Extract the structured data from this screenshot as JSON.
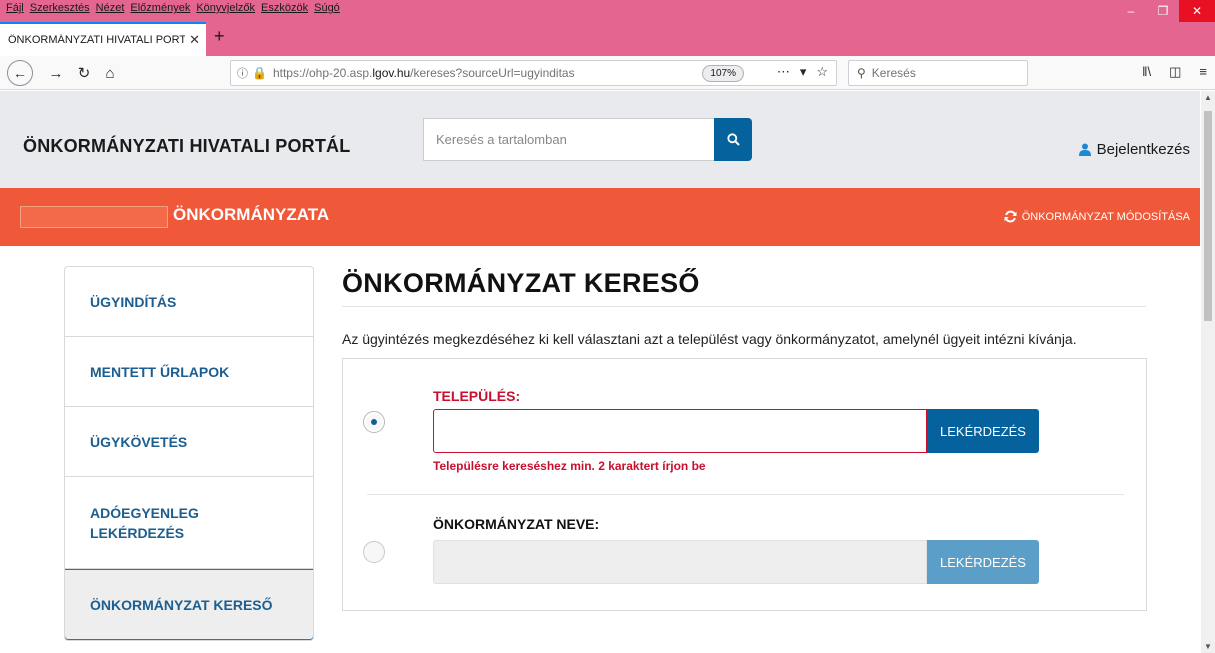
{
  "browser": {
    "menu": [
      "Fájl",
      "Szerkesztés",
      "Nézet",
      "Előzmények",
      "Könyvjelzők",
      "Eszközök",
      "Súgó"
    ],
    "tab_title": "ÖNKORMÁNYZATI HIVATALI PORT",
    "url_prefix": "https://ohp-20.asp.",
    "url_domain": "lgov.hu",
    "url_suffix": "/kereses?sourceUrl=ugyinditas",
    "zoom": "107%",
    "search_placeholder": "Keresés"
  },
  "header": {
    "portal_title": "ÖNKORMÁNYZATI HIVATALI PORTÁL",
    "search_placeholder": "Keresés a tartalomban",
    "login_label": "Bejelentkezés"
  },
  "municipality_bar": {
    "name_suffix": "ÖNKORMÁNYZATA",
    "change_label": "ÖNKORMÁNYZAT MÓDOSÍTÁSA"
  },
  "sidebar": {
    "items": [
      {
        "label": "ÜGYINDÍTÁS"
      },
      {
        "label": "MENTETT ŰRLAPOK"
      },
      {
        "label": "ÜGYKÖVETÉS"
      },
      {
        "label": "ADÓEGYENLEG LEKÉRDEZÉS"
      },
      {
        "label": "ÖNKORMÁNYZAT KERESŐ"
      }
    ]
  },
  "main": {
    "title": "ÖNKORMÁNYZAT KERESŐ",
    "intro": "Az ügyintézés megkezdéséhez ki kell választani azt a települést vagy önkormányzatot, amelynél ügyeit intézni kívánja.",
    "settlement": {
      "label": "TELEPÜLÉS:",
      "value": "",
      "button": "LEKÉRDEZÉS",
      "error": "Településre kereséshez min. 2 karaktert írjon be",
      "selected": true
    },
    "municipality": {
      "label": "ÖNKORMÁNYZAT NEVE:",
      "value": "",
      "button": "LEKÉRDEZÉS",
      "selected": false
    }
  },
  "colors": {
    "accent_blue": "#05629d",
    "orange": "#ef5839",
    "error_red": "#c8102e",
    "browser_chrome": "#e46690"
  }
}
